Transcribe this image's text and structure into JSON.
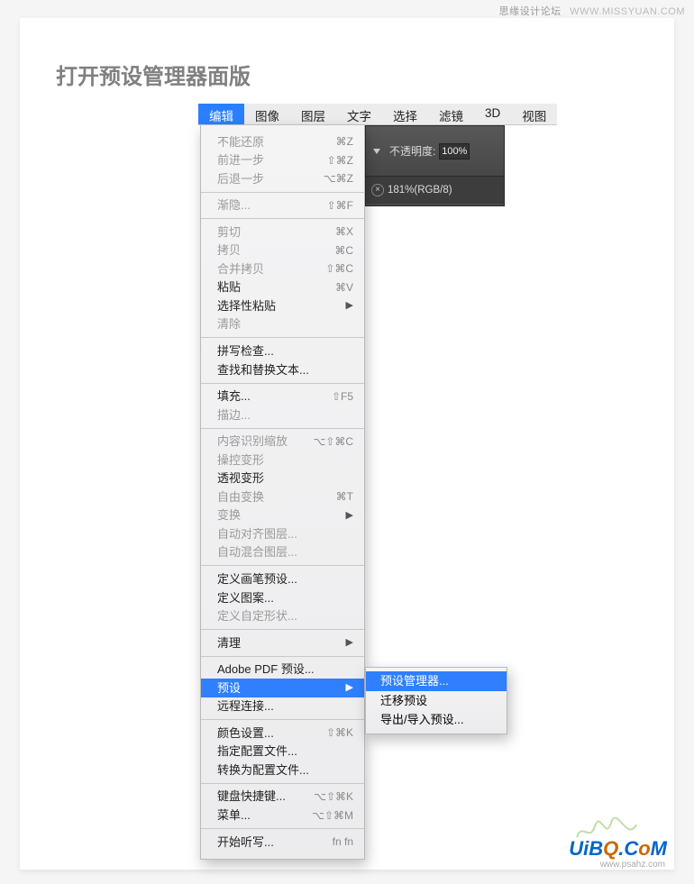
{
  "watermark": {
    "top_left": "思缘设计论坛",
    "top_right": "WWW.MISSYUAN.COM",
    "bottom_logo_1": "UiB",
    "bottom_logo_2": "Q",
    "bottom_logo_3": ".C",
    "bottom_logo_4": "o",
    "bottom_logo_5": "M",
    "bottom_url": "www.psahz.com"
  },
  "title": "打开预设管理器面版",
  "menubar": {
    "items": [
      "编辑",
      "图像",
      "图层",
      "文字",
      "选择",
      "滤镜",
      "3D",
      "视图"
    ],
    "selected_index": 0
  },
  "ps_bar": {
    "opacity_label": "不透明度:",
    "opacity_value": "100%",
    "doc_label": "181%(RGB/8)"
  },
  "menu": {
    "sections": [
      [
        {
          "label": "不能还原",
          "shortcut": "⌘Z",
          "enabled": false
        },
        {
          "label": "前进一步",
          "shortcut": "⇧⌘Z",
          "enabled": false
        },
        {
          "label": "后退一步",
          "shortcut": "⌥⌘Z",
          "enabled": false
        }
      ],
      [
        {
          "label": "渐隐...",
          "shortcut": "⇧⌘F",
          "enabled": false
        }
      ],
      [
        {
          "label": "剪切",
          "shortcut": "⌘X",
          "enabled": false
        },
        {
          "label": "拷贝",
          "shortcut": "⌘C",
          "enabled": false
        },
        {
          "label": "合并拷贝",
          "shortcut": "⇧⌘C",
          "enabled": false
        },
        {
          "label": "粘贴",
          "shortcut": "⌘V",
          "enabled": true
        },
        {
          "label": "选择性粘贴",
          "submenu": true,
          "enabled": true
        },
        {
          "label": "清除",
          "enabled": false
        }
      ],
      [
        {
          "label": "拼写检查...",
          "enabled": true
        },
        {
          "label": "查找和替换文本...",
          "enabled": true
        }
      ],
      [
        {
          "label": "填充...",
          "shortcut": "⇧F5",
          "enabled": true
        },
        {
          "label": "描边...",
          "enabled": false
        }
      ],
      [
        {
          "label": "内容识别缩放",
          "shortcut": "⌥⇧⌘C",
          "enabled": false
        },
        {
          "label": "操控变形",
          "enabled": false
        },
        {
          "label": "透视变形",
          "enabled": true
        },
        {
          "label": "自由变换",
          "shortcut": "⌘T",
          "enabled": false
        },
        {
          "label": "变换",
          "submenu": true,
          "enabled": false
        },
        {
          "label": "自动对齐图层...",
          "enabled": false
        },
        {
          "label": "自动混合图层...",
          "enabled": false
        }
      ],
      [
        {
          "label": "定义画笔预设...",
          "enabled": true
        },
        {
          "label": "定义图案...",
          "enabled": true
        },
        {
          "label": "定义自定形状...",
          "enabled": false
        }
      ],
      [
        {
          "label": "清理",
          "submenu": true,
          "enabled": true
        }
      ],
      [
        {
          "label": "Adobe PDF 预设...",
          "enabled": true
        },
        {
          "label": "预设",
          "submenu": true,
          "enabled": true,
          "highlight": true
        },
        {
          "label": "远程连接...",
          "enabled": true
        }
      ],
      [
        {
          "label": "颜色设置...",
          "shortcut": "⇧⌘K",
          "enabled": true
        },
        {
          "label": "指定配置文件...",
          "enabled": true
        },
        {
          "label": "转换为配置文件...",
          "enabled": true
        }
      ],
      [
        {
          "label": "键盘快捷键...",
          "shortcut": "⌥⇧⌘K",
          "enabled": true
        },
        {
          "label": "菜单...",
          "shortcut": "⌥⇧⌘M",
          "enabled": true
        }
      ],
      [
        {
          "label": "开始听写...",
          "shortcut": "fn fn",
          "enabled": true
        }
      ]
    ]
  },
  "submenu": {
    "items": [
      {
        "label": "预设管理器...",
        "highlight": true
      },
      {
        "label": "迁移预设",
        "highlight": false
      },
      {
        "label": "导出/导入预设...",
        "highlight": false
      }
    ]
  }
}
